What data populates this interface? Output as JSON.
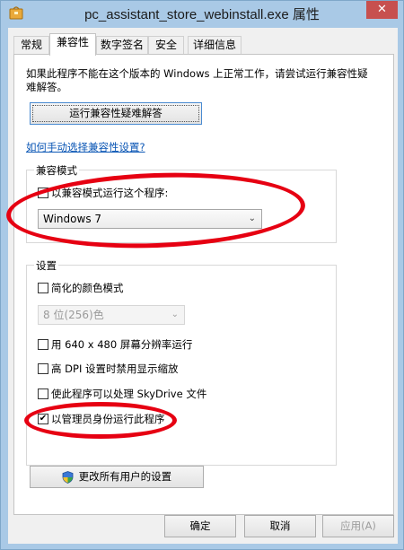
{
  "window": {
    "title": "pc_assistant_store_webinstall.exe 属性",
    "close_label": "✕"
  },
  "tabs": [
    {
      "label": "常规"
    },
    {
      "label": "兼容性"
    },
    {
      "label": "数字签名"
    },
    {
      "label": "安全"
    },
    {
      "label": "详细信息"
    }
  ],
  "intro": "如果此程序不能在这个版本的 Windows 上正常工作，请尝试运行兼容性疑难解答。",
  "troubleshoot_button": "运行兼容性疑难解答",
  "manual_link": "如何手动选择兼容性设置?",
  "compat_mode": {
    "group_title": "兼容模式",
    "checkbox_label": "以兼容模式运行这个程序:",
    "checked": true,
    "selected_os": "Windows 7"
  },
  "settings": {
    "group_title": "设置",
    "reduced_color": {
      "label": "简化的颜色模式",
      "checked": false
    },
    "color_select": "8 位(256)色",
    "res_640": {
      "label": "用 640 x 480 屏幕分辨率运行",
      "checked": false
    },
    "high_dpi": {
      "label": "高 DPI 设置时禁用显示缩放",
      "checked": false
    },
    "skydrive": {
      "label": "使此程序可以处理 SkyDrive 文件",
      "checked": false
    },
    "run_as_admin": {
      "label": "以管理员身份运行此程序",
      "checked": true
    }
  },
  "change_all_users_button": "更改所有用户的设置",
  "buttons": {
    "ok": "确定",
    "cancel": "取消",
    "apply": "应用(A)"
  },
  "check_mark": "✔",
  "colors": {
    "annotation": "#e60012",
    "link": "#0a56b5",
    "titlebar": "#a9c9e6",
    "close": "#c7504f"
  }
}
